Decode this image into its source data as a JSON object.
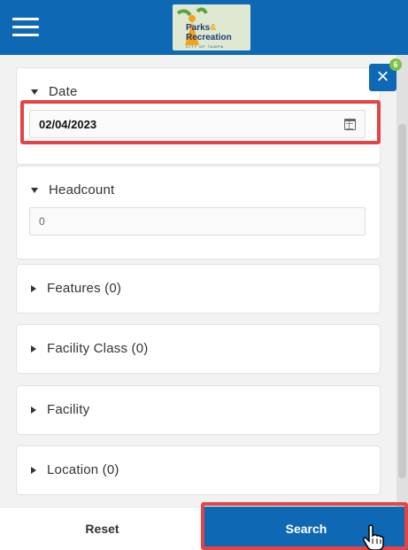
{
  "header": {
    "brand_line1": "Parks",
    "brand_amp": "&",
    "brand_line2": "Recreation",
    "brand_sub": "CITY OF TAMPA"
  },
  "close_badge_count": "6",
  "close_symbol": "×",
  "filters": {
    "date": {
      "label": "Date",
      "value": "02/04/2023"
    },
    "headcount": {
      "label": "Headcount",
      "value": "0"
    },
    "features": {
      "label": "Features (0)"
    },
    "facility_class": {
      "label": "Facility Class (0)"
    },
    "facility": {
      "label": "Facility"
    },
    "location": {
      "label": "Location (0)"
    }
  },
  "footer": {
    "reset_label": "Reset",
    "search_label": "Search"
  },
  "colors": {
    "header": "#0e68b4",
    "highlight": "#e44445",
    "badge": "#7ec242"
  }
}
